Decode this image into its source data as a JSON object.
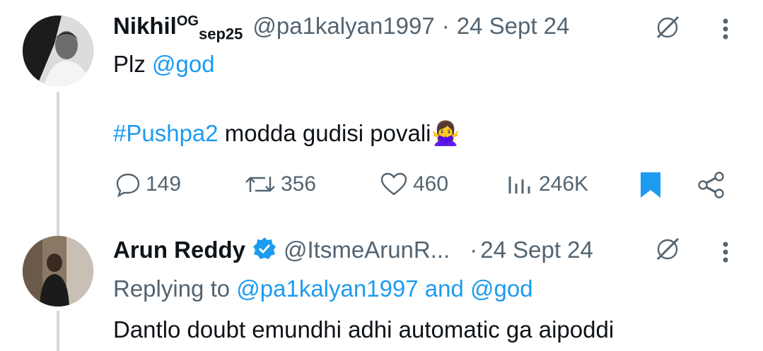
{
  "tweet1": {
    "name": "Nikhil",
    "name_sup": "OG",
    "name_sub": "sep25",
    "handle": "@pa1kalyan1997",
    "sep": "·",
    "date": "24 Sept 24",
    "line1_prefix": "Plz ",
    "mention": "@god",
    "hashtag": "#Pushpa2",
    "line2_text": " modda gudisi povali",
    "emoji": "🙅‍♀️",
    "replies": "149",
    "retweets": "356",
    "likes": "460",
    "views": "246K"
  },
  "tweet2": {
    "name": "Arun Reddy",
    "handle": "@ItsmeArunR...",
    "sep": "·",
    "date": "24 Sept 24",
    "replying_prefix": "Replying to ",
    "replying_user1": "@pa1kalyan1997",
    "replying_and": " and ",
    "replying_user2": "@god",
    "text": "Dantlo  doubt emundhi adhi automatic ga aipoddi"
  },
  "colors": {
    "accent": "#1d9bf0",
    "muted": "#536471",
    "text": "#0f1419",
    "line": "#cfd9de"
  }
}
